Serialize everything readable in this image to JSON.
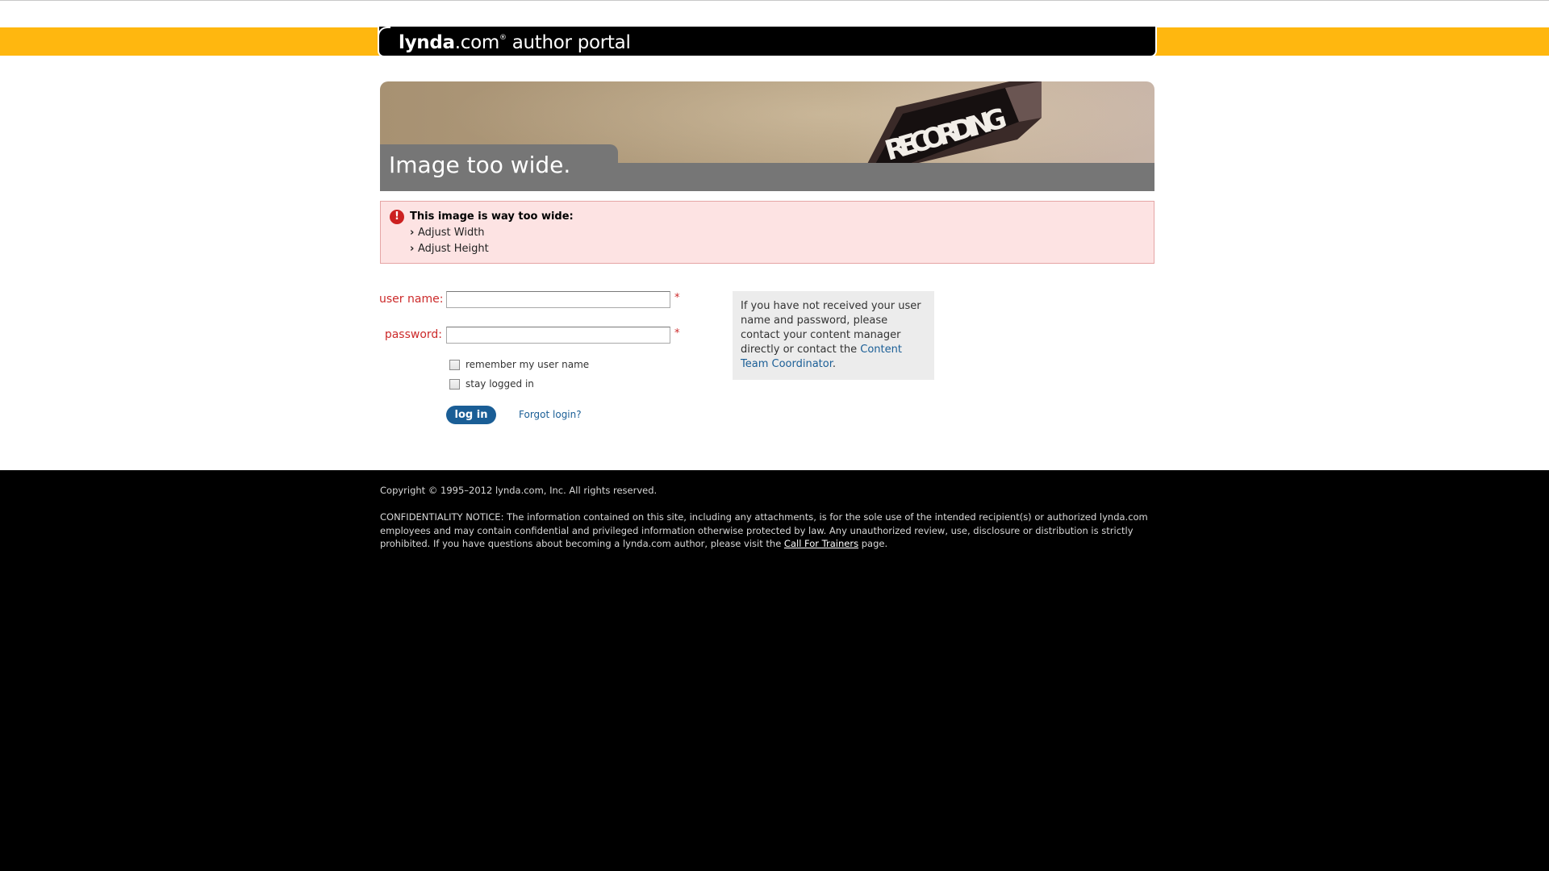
{
  "header": {
    "logo_brand": "lynda",
    "logo_domain": ".com",
    "logo_reg": "®",
    "logo_product": " author portal"
  },
  "banner": {
    "title": "Image too wide.",
    "sign_text": "RECORDING"
  },
  "alert": {
    "heading": "This image is way too wide:",
    "items": [
      "Adjust Width",
      "Adjust Height"
    ],
    "icon": "exclamation-icon",
    "color": "#cc2020"
  },
  "login": {
    "username_label": "user name:",
    "username_value": "",
    "password_label": "password:",
    "password_value": "",
    "required_marker": "*",
    "remember_label": "remember my user name",
    "remember_checked": false,
    "stay_label": "stay logged in",
    "stay_checked": false,
    "button_label": "log in",
    "forgot_label": "Forgot login?"
  },
  "info": {
    "text_before": "If you have not received your user name and password, please contact your content manager directly or contact the ",
    "link_text": "Content Team Coordinator",
    "text_after": "."
  },
  "footer": {
    "copyright": "Copyright © 1995–2012 lynda.com, Inc. All rights reserved.",
    "notice_before": "CONFIDENTIALITY NOTICE: The information contained on this site, including any attachments, is for the sole use of the intended recipient(s) or authorized lynda.com employees and may contain confidential and privileged information otherwise protected by law. Any unauthorized review, use, disclosure or distribution is strictly prohibited. If you have questions about becoming a lynda.com author, please visit the ",
    "notice_link": "Call For Trainers",
    "notice_after": " page."
  },
  "colors": {
    "accent_yellow": "#ffb70f",
    "link_blue": "#1a5e96",
    "error_red": "#cc2a2a",
    "alert_bg": "#fde3e3"
  }
}
